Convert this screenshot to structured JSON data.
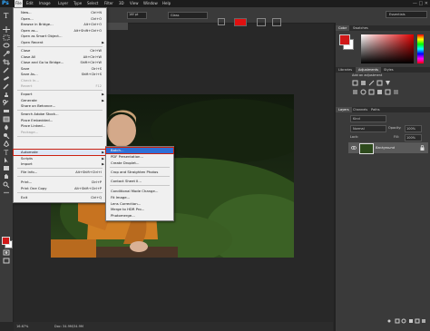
{
  "app": {
    "logo": "Ps"
  },
  "menubar": {
    "items": [
      "File",
      "Edit",
      "Image",
      "Layer",
      "Type",
      "Select",
      "Filter",
      "3D",
      "View",
      "Window",
      "Help"
    ]
  },
  "optionsbar": {
    "preset": "16f pt",
    "color_swatch": "#e01010",
    "workspace": "Essentials",
    "mode": "Glass"
  },
  "document": {
    "tab_title": "IO_79_15.jpg @ 16.6% (RGB/8) ×",
    "zoom": "16.67%",
    "doc_info": "Doc: 34.9M/34.9M"
  },
  "file_menu": {
    "items": [
      {
        "label": "New...",
        "shortcut": "Ctrl+N"
      },
      {
        "label": "Open...",
        "shortcut": "Ctrl+O"
      },
      {
        "label": "Browse in Bridge...",
        "shortcut": "Alt+Ctrl+O"
      },
      {
        "label": "Open as...",
        "shortcut": "Alt+Shift+Ctrl+O"
      },
      {
        "label": "Open as Smart Object..."
      },
      {
        "label": "Open Recent",
        "submenu": true
      },
      {
        "label": "Close",
        "shortcut": "Ctrl+W"
      },
      {
        "label": "Close All",
        "shortcut": "Alt+Ctrl+W"
      },
      {
        "label": "Close and Go to Bridge...",
        "shortcut": "Shift+Ctrl+W"
      },
      {
        "label": "Save",
        "shortcut": "Ctrl+S"
      },
      {
        "label": "Save As...",
        "shortcut": "Shift+Ctrl+S"
      },
      {
        "label": "Check In...",
        "disabled": true
      },
      {
        "label": "Revert",
        "shortcut": "F12",
        "disabled": true
      },
      {
        "label": "Export",
        "submenu": true
      },
      {
        "label": "Generate",
        "submenu": true
      },
      {
        "label": "Share on Behance..."
      },
      {
        "label": "Search Adobe Stock..."
      },
      {
        "label": "Place Embedded..."
      },
      {
        "label": "Place Linked..."
      },
      {
        "label": "Package...",
        "disabled": true
      },
      {
        "label": "Automate",
        "submenu": true,
        "highlighted": true
      },
      {
        "label": "Scripts",
        "submenu": true
      },
      {
        "label": "Import",
        "submenu": true
      },
      {
        "label": "File Info...",
        "shortcut": "Alt+Shift+Ctrl+I"
      },
      {
        "label": "Print...",
        "shortcut": "Ctrl+P"
      },
      {
        "label": "Print One Copy",
        "shortcut": "Alt+Shift+Ctrl+P"
      },
      {
        "label": "Exit",
        "shortcut": "Ctrl+Q"
      }
    ]
  },
  "automate_menu": {
    "items": [
      {
        "label": "Batch...",
        "highlighted": true
      },
      {
        "label": "PDF Presentation..."
      },
      {
        "label": "Create Droplet..."
      },
      {
        "label": "Crop and Straighten Photos"
      },
      {
        "label": "Contact Sheet II..."
      },
      {
        "label": "Conditional Mode Change..."
      },
      {
        "label": "Fit Image..."
      },
      {
        "label": "Lens Correction..."
      },
      {
        "label": "Merge to HDR Pro..."
      },
      {
        "label": "Photomerge..."
      }
    ]
  },
  "panels": {
    "color_tabs": [
      "Color",
      "Swatches"
    ],
    "library_tabs": [
      "Libraries",
      "Adjustments",
      "Styles"
    ],
    "add_adjustment": "Add an adjustment",
    "layers_tabs": [
      "Layers",
      "Channels",
      "Paths"
    ],
    "kind_label": "Kind",
    "blend_mode": "Normal",
    "opacity_label": "Opacity:",
    "opacity_value": "100%",
    "lock_label": "Lock:",
    "fill_label": "Fill:",
    "fill_value": "100%",
    "layer_name": "Background"
  },
  "colors": {
    "fg": "#d01818",
    "bg": "#ffffff",
    "accent": "#2f6fd6"
  }
}
